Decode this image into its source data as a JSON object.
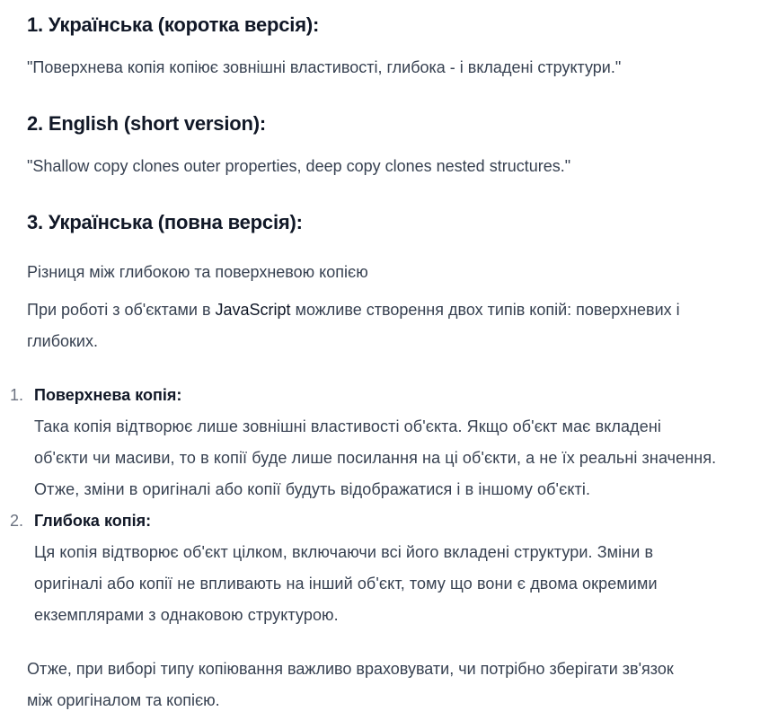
{
  "sections": [
    {
      "heading": "1. Українська (коротка версія):",
      "text": "\"Поверхнева копія копіює зовнішні властивості, глибока - і вкладені структури.\""
    },
    {
      "heading": "2. English (short version):",
      "text": "\"Shallow copy clones outer properties, deep copy clones nested structures.\""
    },
    {
      "heading": "3. Українська (повна версія):",
      "text": ""
    }
  ],
  "full": {
    "title_line": "Різниця між глибокою та поверхневою копією",
    "intro_before": "При роботі з об'єктами в ",
    "intro_js": "JavaScript",
    "intro_after_line1": " можливе створення двох типів копій: поверхневих і",
    "intro_line2": "глибоких.",
    "items": [
      {
        "number": "1.",
        "title": "Поверхнева копія:",
        "lines": [
          "Така копія відтворює лише зовнішні властивості об'єкта. Якщо об'єкт має вкладені",
          "об'єкти чи масиви, то в копії буде лише посилання на ці об'єкти, а не їх реальні значення.",
          "Отже, зміни в оригіналі або копії будуть відображатися і в іншому об'єкті."
        ]
      },
      {
        "number": "2.",
        "title": "Глибока копія:",
        "lines": [
          "Ця копія відтворює об'єкт цілком, включаючи всі його вкладені структури. Зміни в",
          "оригіналі або копії не впливають на інший об'єкт, тому що вони є двома окремими",
          "екземплярами з однаковою структурою."
        ]
      }
    ],
    "conclusion_line1": "Отже, при виборі типу копіювання важливо враховувати, чи потрібно зберігати зв'язок",
    "conclusion_line2": "між оригіналом та копією."
  }
}
